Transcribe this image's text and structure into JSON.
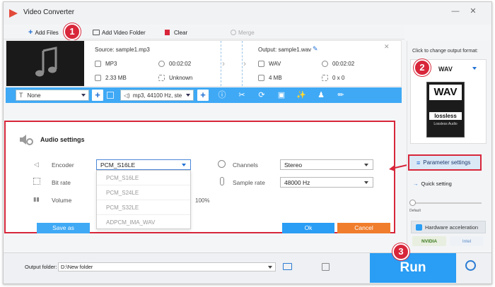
{
  "app": {
    "title": "Video Converter"
  },
  "toolbar": {
    "add_files": "Add Files",
    "add_video_folder": "Add Video Folder",
    "clear": "Clear",
    "merge": "Merge"
  },
  "badges": [
    "1",
    "2",
    "3"
  ],
  "file": {
    "source_label": "Source: sample1.mp3",
    "source_format": "MP3",
    "source_duration": "00:02:02",
    "source_size": "2.33 MB",
    "source_resolution": "Unknown",
    "output_label": "Output: sample1.wav",
    "output_format": "WAV",
    "output_duration": "00:02:02",
    "output_size": "4 MB",
    "output_resolution": "0 x 0"
  },
  "editbar": {
    "subtitle": "None",
    "audio_track": "mp3, 44100 Hz, ste"
  },
  "audio_settings": {
    "title": "Audio settings",
    "encoder_label": "Encoder",
    "encoder_value": "PCM_S16LE",
    "encoder_options": [
      "PCM_S16LE",
      "PCM_S24LE",
      "PCM_S32LE",
      "ADPCM_IMA_WAV"
    ],
    "bitrate_label": "Bit rate",
    "volume_label": "Volume",
    "volume_value": "100%",
    "channels_label": "Channels",
    "channels_value": "Stereo",
    "samplerate_label": "Sample rate",
    "samplerate_value": "48000 Hz",
    "save_as": "Save as",
    "ok": "Ok",
    "cancel": "Cancel"
  },
  "output_format": {
    "hint": "Click to change output format:",
    "selected": "WAV",
    "card_title": "WAV",
    "card_brand": "lossless",
    "card_caption": "Lossless Audio"
  },
  "right_panel": {
    "parameter_settings": "Parameter settings",
    "quick_setting": "Quick setting",
    "slider_label": "Default",
    "hardware_acceleration": "Hardware acceleration",
    "nvidia": "NVIDIA",
    "intel": "Intel"
  },
  "bottom": {
    "output_folder_label": "Output folder:",
    "output_folder_value": "D:\\New folder",
    "run": "Run"
  },
  "colors": {
    "accent_blue": "#3fa9f5",
    "badge_red": "#d8263a",
    "ok_blue": "#2a9df4",
    "cancel_orange": "#f07d2c"
  }
}
